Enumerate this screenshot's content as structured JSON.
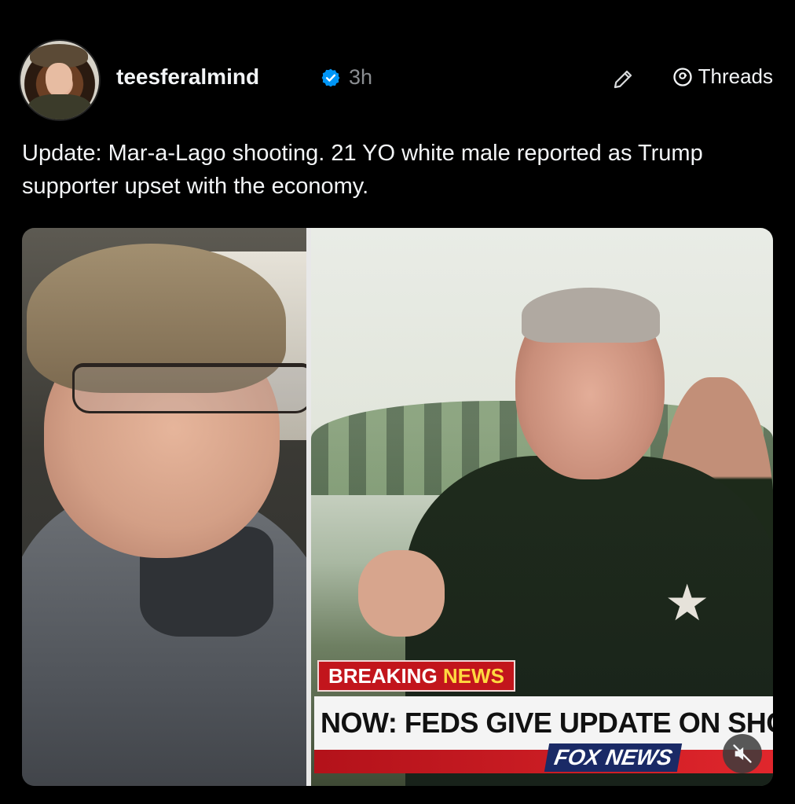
{
  "post": {
    "username": "teesferalmind",
    "time": "3h",
    "app_link_label": "Threads",
    "text": "Update: Mar-a-Lago shooting. 21 YO white male reported as Trump supporter upset with the economy."
  },
  "media": {
    "chyron": {
      "breaking_word": "BREAKING",
      "news_word": "NEWS",
      "headline": "NOW: FEDS GIVE UPDATE ON SHOO",
      "network": "FOX NEWS"
    }
  },
  "icons": {
    "verified": "verified-badge-icon",
    "edit": "pencil-edit-icon",
    "threads": "threads-logo-icon",
    "mute": "muted-speaker-icon"
  },
  "colors": {
    "background": "#000000",
    "verified_blue": "#0095f6",
    "secondary_text": "#8a8d91",
    "breaking_red": "#c2151c"
  }
}
